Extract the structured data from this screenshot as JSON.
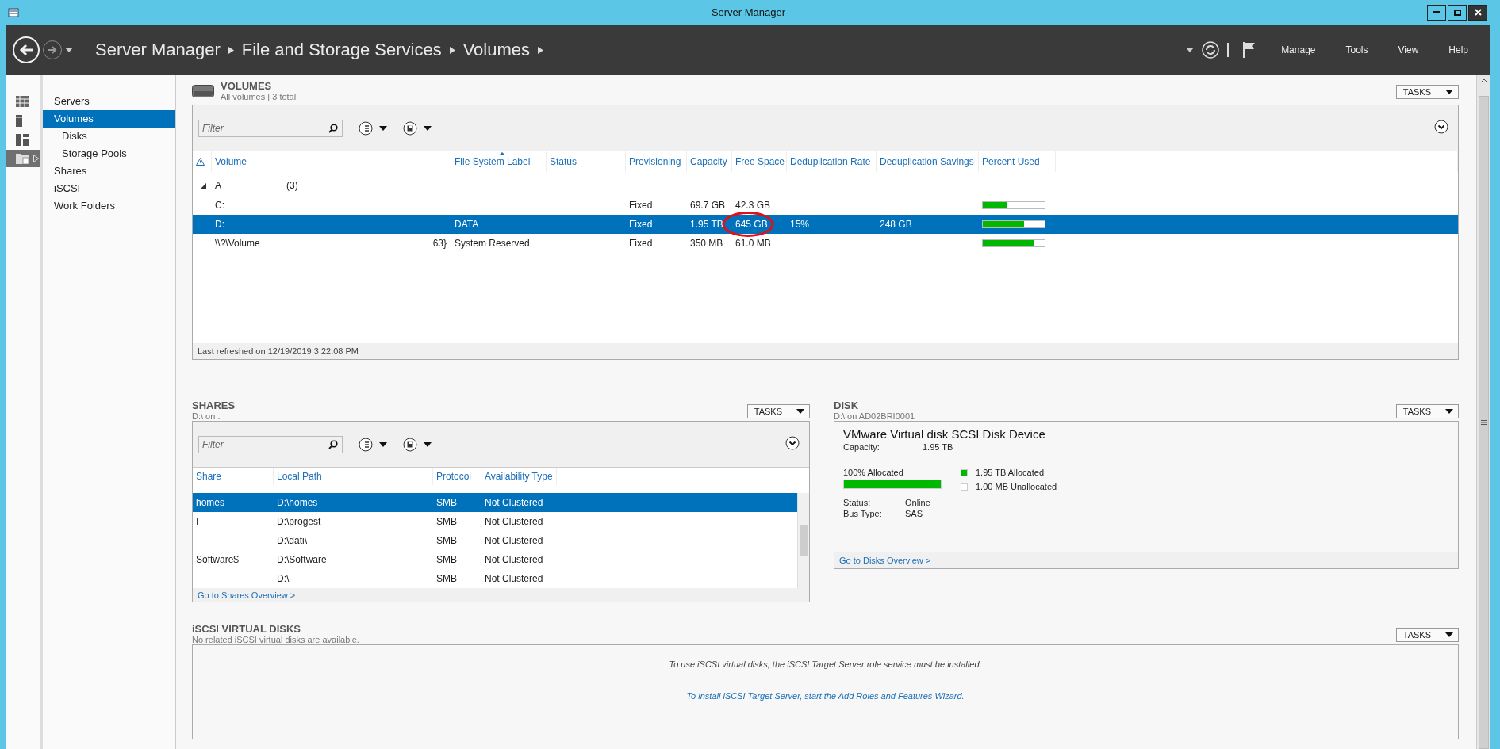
{
  "window": {
    "title": "Server Manager"
  },
  "header": {
    "breadcrumb": [
      "Server Manager",
      "File and Storage Services",
      "Volumes"
    ],
    "menus": [
      "Manage",
      "Tools",
      "View",
      "Help"
    ]
  },
  "side_icons": [
    {
      "kind": "table",
      "selected": false
    },
    {
      "kind": "server",
      "selected": false
    },
    {
      "kind": "panels",
      "selected": false
    },
    {
      "kind": "storage",
      "selected": true
    }
  ],
  "nav": {
    "items": [
      {
        "label": "Servers",
        "selected": false
      },
      {
        "label": "Volumes",
        "selected": true,
        "children": [
          {
            "label": "Disks",
            "selected": false
          },
          {
            "label": "Storage Pools",
            "selected": false
          }
        ]
      },
      {
        "label": "Shares",
        "selected": false
      },
      {
        "label": "iSCSI",
        "selected": false
      },
      {
        "label": "Work Folders",
        "selected": false
      }
    ]
  },
  "volumes": {
    "title": "VOLUMES",
    "subtitle": "All volumes | 3 total",
    "tasks": "TASKS",
    "filter": {
      "placeholder": "Filter"
    },
    "columns": [
      {
        "label": "Volume",
        "sorted": false
      },
      {
        "label": "File System Label",
        "sorted": true
      },
      {
        "label": "Status",
        "sorted": false
      },
      {
        "label": "Provisioning",
        "sorted": false
      },
      {
        "label": "Capacity",
        "sorted": false
      },
      {
        "label": "Free Space",
        "sorted": false
      },
      {
        "label": "Deduplication Rate",
        "sorted": false
      },
      {
        "label": "Deduplication Savings",
        "sorted": false
      },
      {
        "label": "Percent Used",
        "sorted": false
      }
    ],
    "groups": [
      {
        "name": "A",
        "count": "(3)",
        "expanded": true,
        "rows": [
          {
            "volume": "C:",
            "provisioning": "Fixed",
            "capacity": "69.7 GB",
            "free_space": "42.3 GB",
            "level": 0.39,
            "selected": false,
            "free_space_circled": false
          },
          {
            "volume": "D:",
            "label": "DATA",
            "provisioning": "Fixed",
            "capacity": "1.95 TB",
            "free_space": "645 GB",
            "dedup_rate": "15%",
            "dedup_savings": "248 GB",
            "level": 0.67,
            "selected": true,
            "free_space_circled": true
          },
          {
            "volume": "\\\\?\\Volume",
            "volume_tail": "63}",
            "label": "System Reserved",
            "provisioning": "Fixed",
            "capacity": "350 MB",
            "free_space": "61.0 MB",
            "level": 0.82,
            "selected": false,
            "free_space_circled": false
          }
        ]
      }
    ],
    "status": "Last refreshed on 12/19/2019 3:22:08 PM"
  },
  "shares": {
    "title": "SHARES",
    "subtitle": "D:\\ on .",
    "tasks": "TASKS",
    "filter": {
      "placeholder": "Filter"
    },
    "columns": [
      "Share",
      "Local Path",
      "Protocol",
      "Availability Type"
    ],
    "rows": [
      {
        "share": "homes",
        "path": "D:\\homes",
        "protocol": "SMB",
        "availability": "Not Clustered",
        "selected": true
      },
      {
        "share": "I",
        "path": "D:\\progest",
        "protocol": "SMB",
        "availability": "Not Clustered",
        "selected": false
      },
      {
        "path": "D:\\dati\\",
        "protocol": "SMB",
        "availability": "Not Clustered",
        "selected": false
      },
      {
        "share": "Software$",
        "path": "D:\\Software",
        "protocol": "SMB",
        "availability": "Not Clustered",
        "selected": false
      },
      {
        "path": "D:\\",
        "protocol": "SMB",
        "availability": "Not Clustered",
        "selected": false
      }
    ],
    "link": "Go to Shares Overview >"
  },
  "disk": {
    "title": "DISK",
    "subtitle": "D:\\ on AD02BRI0001",
    "tasks": "TASKS",
    "device": "VMware Virtual disk SCSI Disk Device",
    "capacity_label": "Capacity:",
    "capacity": "1.95 TB",
    "allocation": {
      "label": "100% Allocated",
      "level": 1
    },
    "legend": [
      {
        "label": "1.95 TB Allocated",
        "color": "#00b800"
      },
      {
        "label": "1.00 MB Unallocated",
        "color": "#ffffff"
      }
    ],
    "properties": [
      {
        "label": "Status:",
        "value": "Online"
      },
      {
        "label": "Bus Type:",
        "value": "SAS"
      }
    ],
    "link": "Go to Disks Overview >"
  },
  "iscsi": {
    "title": "iSCSI VIRTUAL DISKS",
    "subtitle": "No related iSCSI virtual disks are available.",
    "tasks": "TASKS",
    "message": "To use iSCSI virtual disks, the iSCSI Target Server role service must be installed.",
    "link": "To install iSCSI Target Server, start the Add Roles and Features Wizard."
  }
}
